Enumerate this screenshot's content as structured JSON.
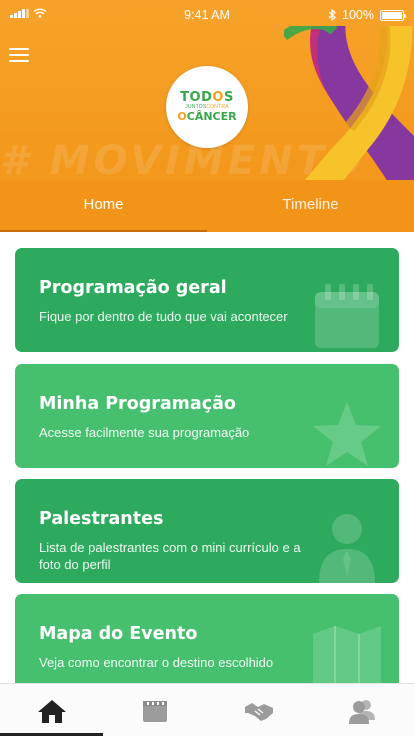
{
  "status_bar": {
    "time": "9:41 AM",
    "battery_text": "100%",
    "battery_level": 1.0
  },
  "header": {
    "watermark": "# MOVIMENTO TODOS",
    "logo": {
      "line1": "TODOS",
      "line2_a": "JUNTOS",
      "line2_b": "CONTRA",
      "line3": "CÂNCER"
    }
  },
  "tabs": [
    {
      "label": "Home",
      "active": true
    },
    {
      "label": "Timeline",
      "active": false
    }
  ],
  "cards": [
    {
      "title": "Programação geral",
      "subtitle": "Fique por dentro de tudo que vai acontecer",
      "icon": "calendar-icon",
      "color": "#2eaa5e"
    },
    {
      "title": "Minha Programação",
      "subtitle": "Acesse facilmente sua programação",
      "icon": "star-icon",
      "color": "#46c06e"
    },
    {
      "title": "Palestrantes",
      "subtitle": "Lista de palestrantes com o mini currículo e a foto do perfil",
      "icon": "person-icon",
      "color": "#2eaa5e"
    },
    {
      "title": "Mapa do Evento",
      "subtitle": "Veja como encontrar o destino escolhido",
      "icon": "map-icon",
      "color": "#46c06e"
    }
  ],
  "bottom_nav": [
    {
      "icon": "home-icon",
      "active": true
    },
    {
      "icon": "film-icon",
      "active": false
    },
    {
      "icon": "handshake-icon",
      "active": false
    },
    {
      "icon": "users-icon",
      "active": false
    }
  ],
  "colors": {
    "header_orange": "#f39a1e",
    "card_green_dark": "#2eaa5e",
    "card_green_light": "#46c06e",
    "tab_indicator": "#c86a05",
    "nav_active": "#222222",
    "nav_inactive": "#9b9b9b"
  }
}
